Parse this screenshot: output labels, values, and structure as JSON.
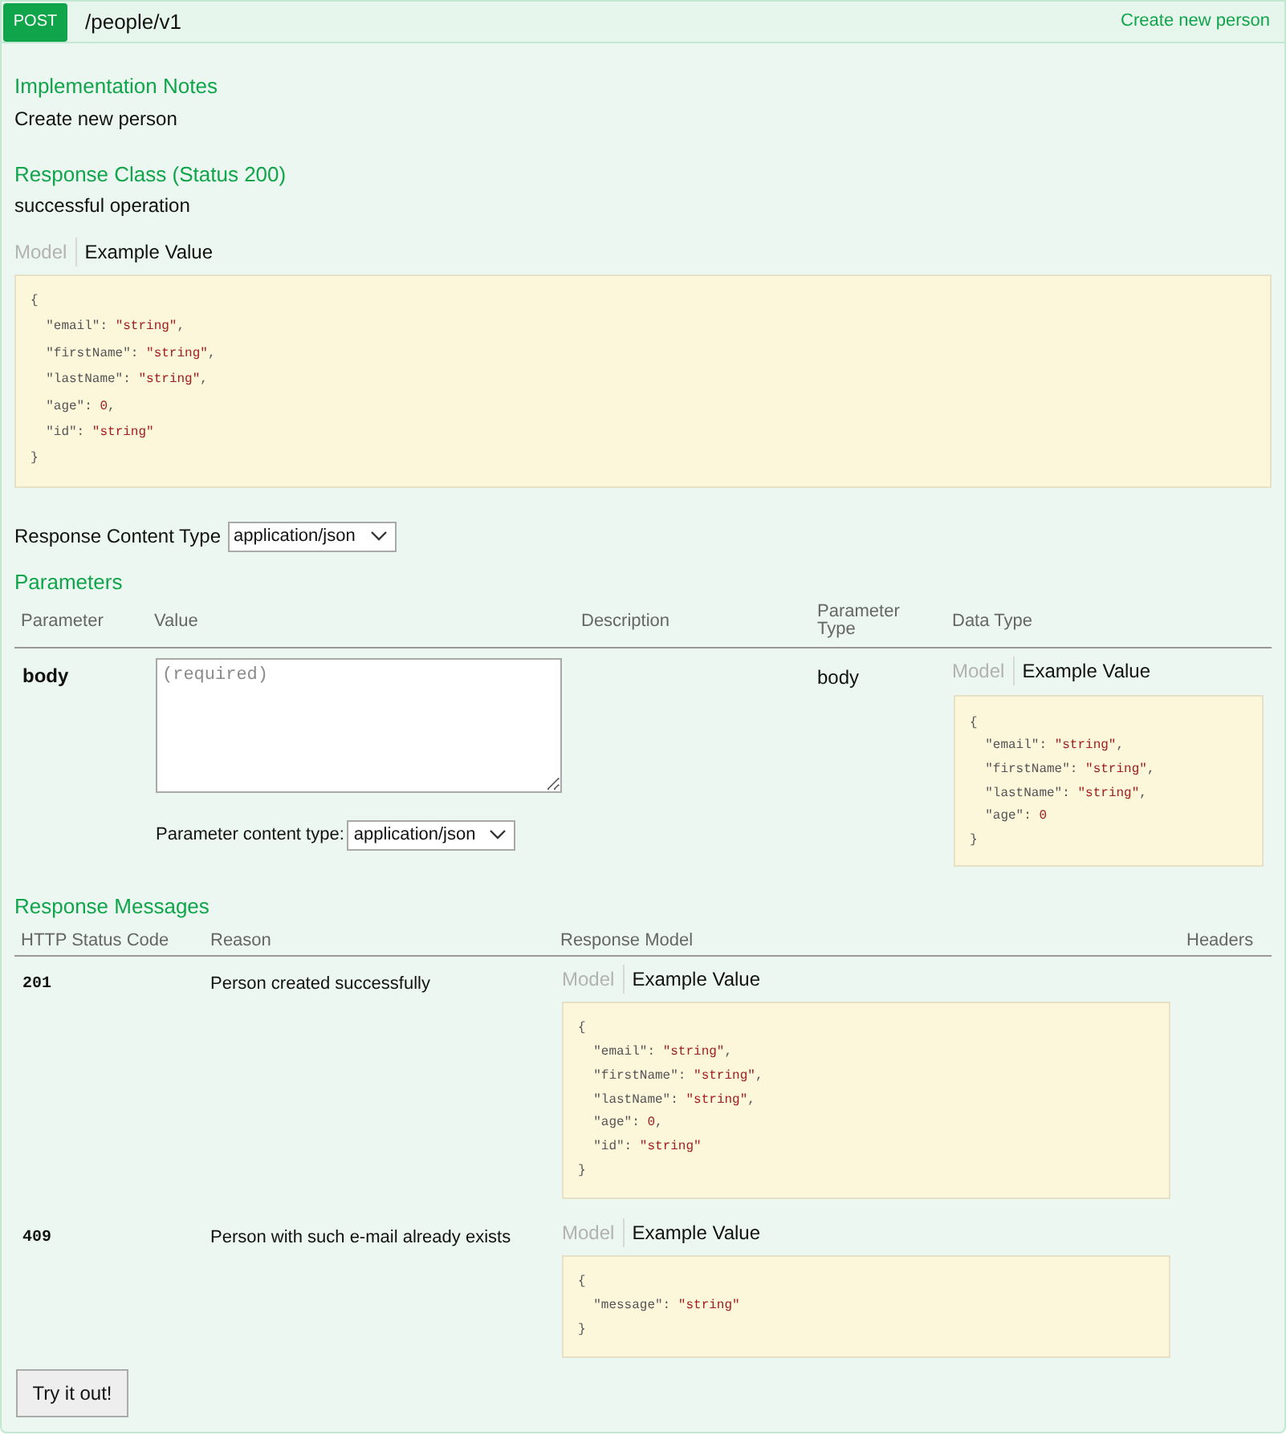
{
  "operation": {
    "method": "POST",
    "path": "/people/v1",
    "summary": "Create new person"
  },
  "implementation_notes": {
    "heading": "Implementation Notes",
    "text": "Create new person"
  },
  "response_class": {
    "heading": "Response Class (Status 200)",
    "text": "successful operation",
    "tabs": [
      {
        "label": "Model",
        "selected": false
      },
      {
        "label": "Example Value",
        "selected": true
      }
    ],
    "example": [
      "{",
      "  \"email\": \"string\",",
      "  \"firstName\": \"string\",",
      "  \"lastName\": \"string\",",
      "  \"age\": 0,",
      "  \"id\": \"string\"",
      "}"
    ]
  },
  "response_content_type": {
    "label": "Response Content Type",
    "value": "application/json"
  },
  "parameters": {
    "heading": "Parameters",
    "columns": [
      "Parameter",
      "Value",
      "Description",
      "Parameter Type",
      "Data Type"
    ],
    "rows": [
      {
        "name": "body",
        "placeholder": "(required)",
        "content_type_label": "Parameter content type:",
        "content_type": "application/json",
        "parameter_type": "body",
        "data_type": {
          "tabs": [
            {
              "label": "Model",
              "selected": false
            },
            {
              "label": "Example Value",
              "selected": true
            }
          ],
          "example": [
            "{",
            "  \"email\": \"string\",",
            "  \"firstName\": \"string\",",
            "  \"lastName\": \"string\",",
            "  \"age\": 0",
            "}"
          ]
        }
      }
    ]
  },
  "response_messages": {
    "heading": "Response Messages",
    "columns": [
      "HTTP Status Code",
      "Reason",
      "Response Model",
      "Headers"
    ],
    "rows": [
      {
        "code": "201",
        "reason": "Person created successfully",
        "model": {
          "tabs": [
            {
              "label": "Model",
              "selected": false
            },
            {
              "label": "Example Value",
              "selected": true
            }
          ],
          "example": [
            "{",
            "  \"email\": \"string\",",
            "  \"firstName\": \"string\",",
            "  \"lastName\": \"string\",",
            "  \"age\": 0,",
            "  \"id\": \"string\"",
            "}"
          ]
        }
      },
      {
        "code": "409",
        "reason": "Person with such e-mail already exists",
        "model": {
          "tabs": [
            {
              "label": "Model",
              "selected": false
            },
            {
              "label": "Example Value",
              "selected": true
            }
          ],
          "example": [
            "{",
            "  \"message\": \"string\"",
            "}"
          ]
        }
      }
    ]
  },
  "try_button": {
    "label": "Try it out!"
  }
}
